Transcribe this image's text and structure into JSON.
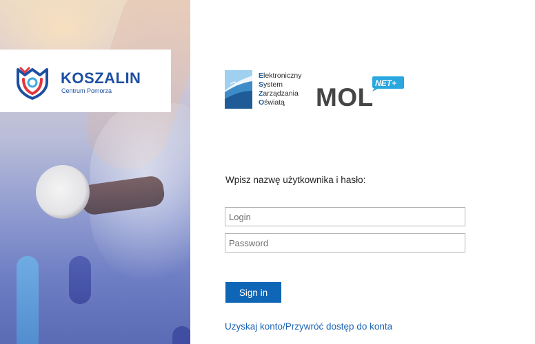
{
  "brand": {
    "name": "KOSZALIN",
    "subtitle": "Centrum Pomorza"
  },
  "eszo_logo": {
    "lines": [
      {
        "initial": "E",
        "rest": "lektroniczny"
      },
      {
        "initial": "S",
        "rest": "ystem"
      },
      {
        "initial": "Z",
        "rest": "arządzania"
      },
      {
        "initial": "O",
        "rest": "światą"
      }
    ]
  },
  "mol_logo": {
    "text": "MOL",
    "badge": "NET+"
  },
  "login_form": {
    "prompt": "Wpisz nazwę użytkownika i hasło:",
    "login_placeholder": "Login",
    "password_placeholder": "Password",
    "signin_label": "Sign in",
    "account_link": "Uzyskaj konto/Przywróć dostęp do konta"
  },
  "colors": {
    "primary_button": "#0f65b6",
    "link": "#1b63b2",
    "brand_blue": "#1d4fa1",
    "brand_red": "#e3363f"
  }
}
